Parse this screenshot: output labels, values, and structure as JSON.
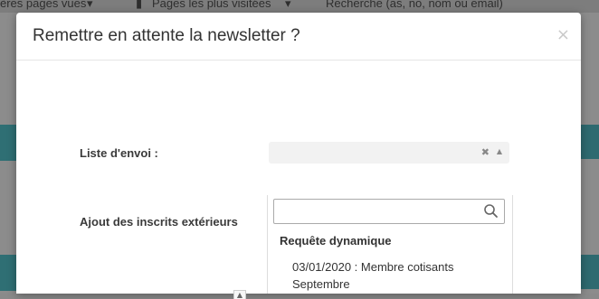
{
  "background": {
    "nav_item_1": "ères pages vues",
    "nav_item_2": "Pages les plus visitées",
    "search_placeholder": "Recherche (as, no, nom ou email)"
  },
  "modal": {
    "title": "Remettre en attente la newsletter ?",
    "close": "×"
  },
  "form": {
    "mailing_list_label": "Liste d'envoi :",
    "mailing_list_value": "",
    "clear_glyph": "✖",
    "arrow_glyph": "▲",
    "external_subscribers_label": "Ajout des inscrits extérieurs"
  },
  "dropdown": {
    "search_value": "",
    "group_label": "Requête dynamique",
    "options": [
      {
        "label": "03/01/2020 : Membre cotisants Septembre"
      }
    ]
  },
  "colors": {
    "overlay": "#8a8a8a",
    "accent_teal": "#2f6f74",
    "modal_bg": "#ffffff"
  }
}
